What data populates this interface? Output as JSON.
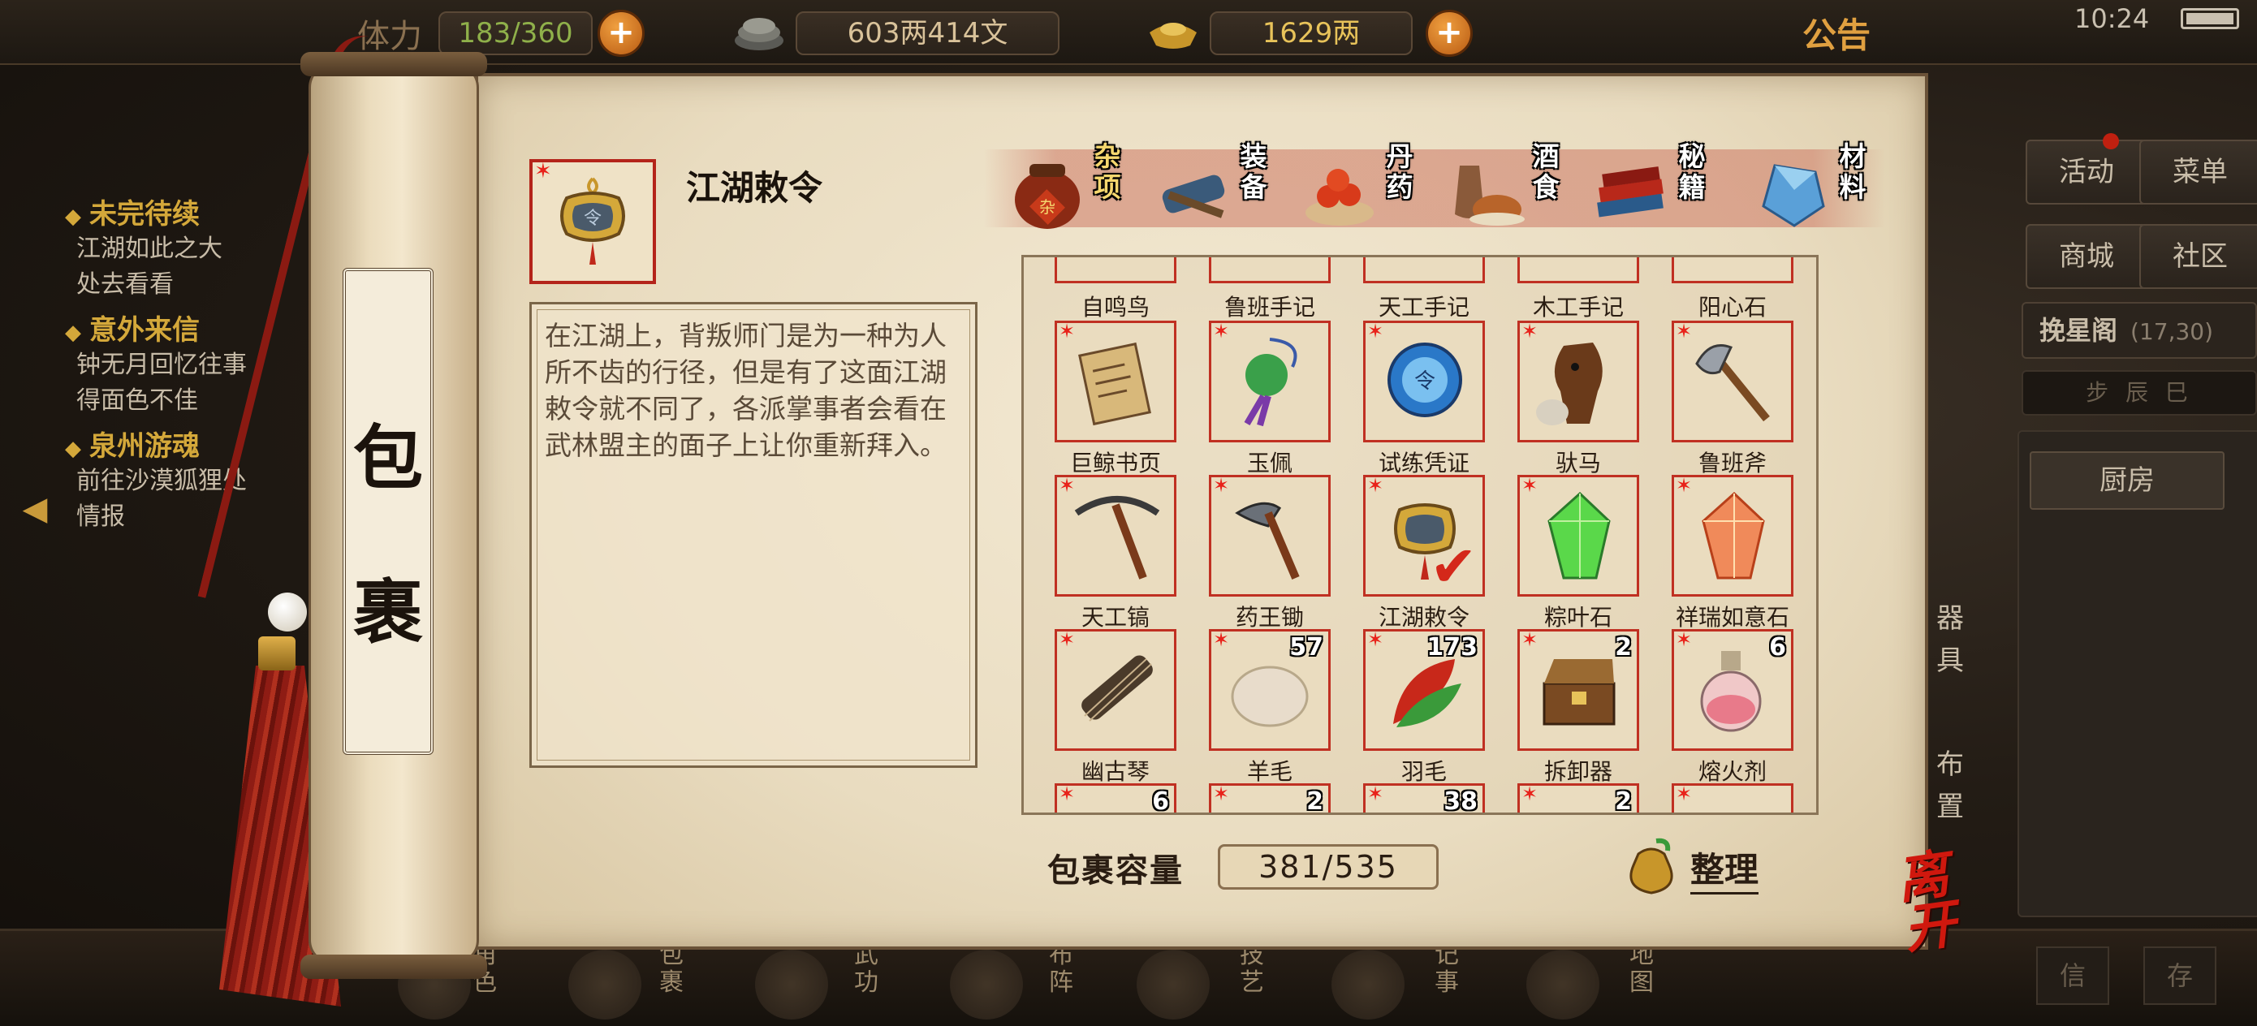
{
  "topbar": {
    "stamina_label": "体力",
    "stamina": "183/360",
    "money": "603两414文",
    "gold": "1629两",
    "notice": "公告",
    "clock": "10:24"
  },
  "quests": [
    {
      "title": "未完待续",
      "desc": [
        "江湖如此之大",
        "处去看看"
      ]
    },
    {
      "title": "意外来信",
      "desc": [
        "钟无月回忆往事",
        "得面色不佳"
      ]
    },
    {
      "title": "泉州游魂",
      "desc": [
        "前往沙漠狐狸处",
        "情报"
      ]
    }
  ],
  "right_menu": {
    "activity": "活动",
    "menu": "菜单",
    "shop": "商城",
    "community": "社区",
    "star_ring": "挽星阁",
    "star_ring_coords": "(17,30)",
    "bag_mini": "步 辰 巳",
    "kitchen": "厨房",
    "tools": "器具",
    "layout": "布置",
    "bottom1": "信",
    "bottom2": "存"
  },
  "bottom_nav": {
    "role": "角色",
    "bag": "包裹",
    "martial": "武功",
    "layout": "布阵",
    "skill": "技艺",
    "journal": "记事",
    "map": "地图"
  },
  "scroll_title": "包裹",
  "selected": {
    "name": "江湖敕令",
    "description": "在江湖上，背叛师门是为一种为人所不齿的行径，但是有了这面江湖敕令就不同了，各派掌事者会看在武林盟主的面子上让你重新拜入。"
  },
  "tabs": [
    {
      "label": "杂项",
      "icon": "jar-icon",
      "active": true
    },
    {
      "label": "装备",
      "icon": "scroll-sword-icon",
      "active": false
    },
    {
      "label": "丹药",
      "icon": "pills-icon",
      "active": false
    },
    {
      "label": "酒食",
      "icon": "food-icon",
      "active": false
    },
    {
      "label": "秘籍",
      "icon": "books-icon",
      "active": false
    },
    {
      "label": "材料",
      "icon": "crystal-icon",
      "active": false
    }
  ],
  "items_top_row": [
    "自鸣鸟",
    "鲁班手记",
    "天工手记",
    "木工手记",
    "阳心石"
  ],
  "items": [
    {
      "name": "巨鲸书页",
      "icon": "paper-icon",
      "count": ""
    },
    {
      "name": "玉佩",
      "icon": "jade-pendant-icon",
      "count": ""
    },
    {
      "name": "试练凭证",
      "icon": "token-icon",
      "count": ""
    },
    {
      "name": "驮马",
      "icon": "horse-icon",
      "count": ""
    },
    {
      "name": "鲁班斧",
      "icon": "axe-icon",
      "count": ""
    },
    {
      "name": "天工镐",
      "icon": "pickaxe-icon",
      "count": ""
    },
    {
      "name": "药王锄",
      "icon": "hoe-icon",
      "count": ""
    },
    {
      "name": "江湖敕令",
      "icon": "edict-icon",
      "count": "",
      "selected": true
    },
    {
      "name": "粽叶石",
      "icon": "green-crystal-icon",
      "count": ""
    },
    {
      "name": "祥瑞如意石",
      "icon": "fire-crystal-icon",
      "count": ""
    },
    {
      "name": "幽古琴",
      "icon": "zither-icon",
      "count": ""
    },
    {
      "name": "羊毛",
      "icon": "wool-icon",
      "count": "57"
    },
    {
      "name": "羽毛",
      "icon": "feather-icon",
      "count": "173"
    },
    {
      "name": "拆卸器",
      "icon": "chest-icon",
      "count": "2"
    },
    {
      "name": "熔火剂",
      "icon": "potion-icon",
      "count": "6"
    }
  ],
  "items_bottom_counts": [
    "6",
    "2",
    "38",
    "2",
    ""
  ],
  "capacity_label": "包裹容量",
  "capacity": "381/535",
  "sort_label": "整理",
  "leave_label": "离开",
  "colors": {
    "accent_red": "#c03022",
    "paper": "#efe4cc",
    "gold": "#e8c35a"
  }
}
